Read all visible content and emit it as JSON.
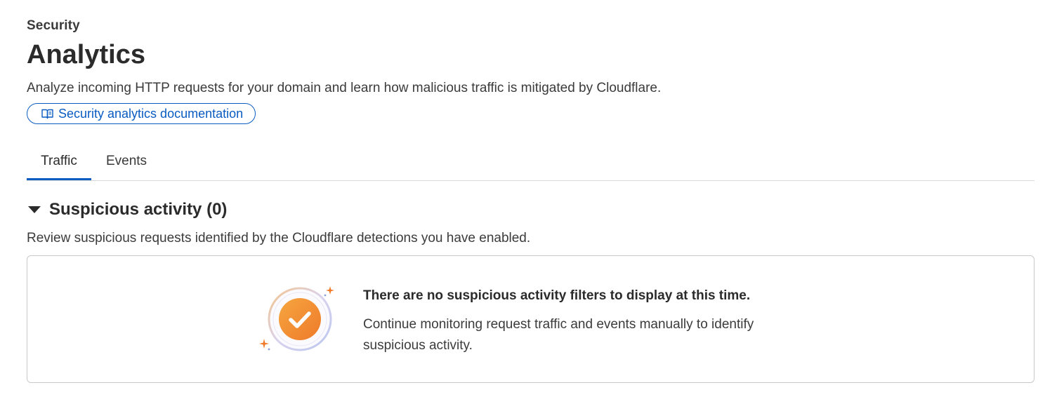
{
  "header": {
    "breadcrumb": "Security",
    "title": "Analytics",
    "description": "Analyze incoming HTTP requests for your domain and learn how malicious traffic is mitigated by Cloudflare.",
    "doc_button_label": "Security analytics documentation",
    "doc_button_icon": "book-icon"
  },
  "tabs": [
    {
      "label": "Traffic",
      "active": true
    },
    {
      "label": "Events",
      "active": false
    }
  ],
  "section": {
    "title": "Suspicious activity (0)",
    "expanded": true,
    "description": "Review suspicious requests identified by the Cloudflare detections you have enabled."
  },
  "empty_state": {
    "heading": "There are no suspicious activity filters to display at this time.",
    "body": "Continue monitoring request traffic and events manually to identify suspicious activity.",
    "icon": "checkmark-badge-icon"
  },
  "colors": {
    "accent": "#0a5cc2",
    "badge_orange": "#f0892a"
  }
}
